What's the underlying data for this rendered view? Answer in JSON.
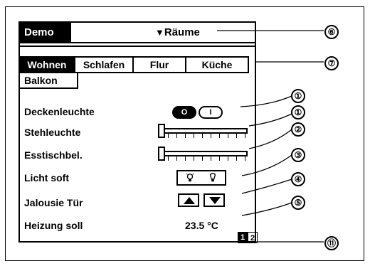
{
  "titlebar": {
    "app_name": "Demo",
    "rooms_menu": "Räume"
  },
  "tabs": [
    {
      "label": "Wohnen",
      "active": true
    },
    {
      "label": "Schlafen",
      "active": false
    },
    {
      "label": "Flur",
      "active": false
    },
    {
      "label": "Küche",
      "active": false
    }
  ],
  "extra_tab": {
    "label": "Balkon"
  },
  "controls": {
    "deckenleuchte": {
      "label": "Deckenleuchte",
      "off_label": "O",
      "on_label": "I",
      "state": "off"
    },
    "stehleuchte": {
      "label": "Stehleuchte",
      "level": 0.0
    },
    "esstischbel": {
      "label": "Esstischbel.",
      "level": 0.0
    },
    "licht_soft": {
      "label": "Licht soft"
    },
    "jalousie": {
      "label": "Jalousie Tür"
    },
    "heizung": {
      "label": "Heizung soll",
      "value": "23.5 °C"
    }
  },
  "pager": {
    "pages": [
      "1",
      "2"
    ],
    "current": "1"
  },
  "callouts": [
    "⑥",
    "⑦",
    "①",
    "①",
    "②",
    "③",
    "④",
    "⑤",
    "⑪"
  ]
}
